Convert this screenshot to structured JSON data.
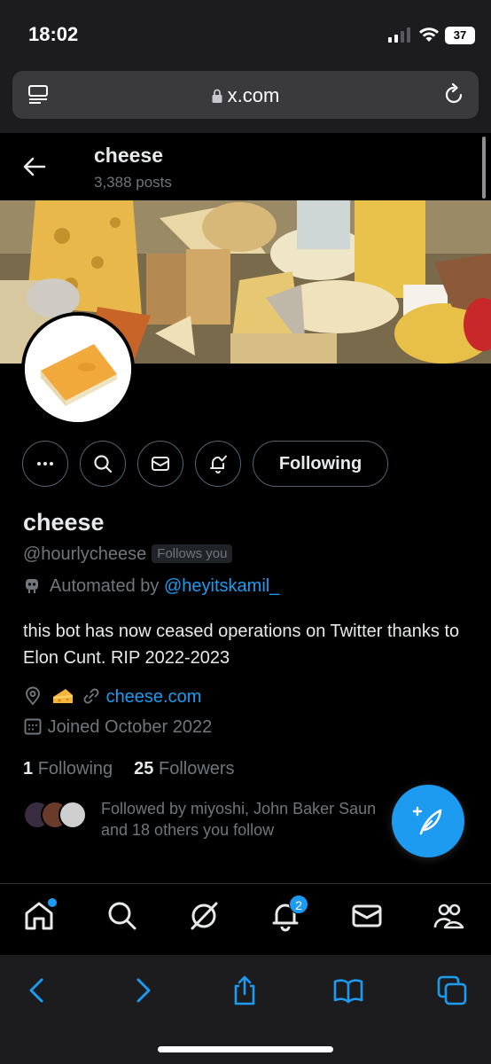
{
  "status": {
    "time": "18:02",
    "battery": "37"
  },
  "browser": {
    "url": "x.com"
  },
  "header": {
    "name": "cheese",
    "posts": "3,388 posts"
  },
  "actions": {
    "following_label": "Following"
  },
  "profile": {
    "display_name": "cheese",
    "handle": "@hourlycheese",
    "follows_you": "Follows you",
    "automated_prefix": "Automated by",
    "automated_by": "@heyitskamil_",
    "bio": "this bot has now ceased operations on Twitter thanks to Elon Cunt. RIP 2022-2023",
    "location_emoji": "cheese-wedge",
    "website": "cheese.com",
    "joined": "Joined October 2022",
    "following_count": "1",
    "following_label": "Following",
    "followers_count": "25",
    "followers_label": "Followers",
    "followed_by_line1": "Followed by miyoshi, John Baker Saun",
    "followed_by_line2": "and 18 others you follow"
  },
  "tabs": {
    "notifications_badge": "2"
  },
  "colors": {
    "accent": "#1d9bf0",
    "secondary_text": "#71767b",
    "border": "#536471"
  }
}
